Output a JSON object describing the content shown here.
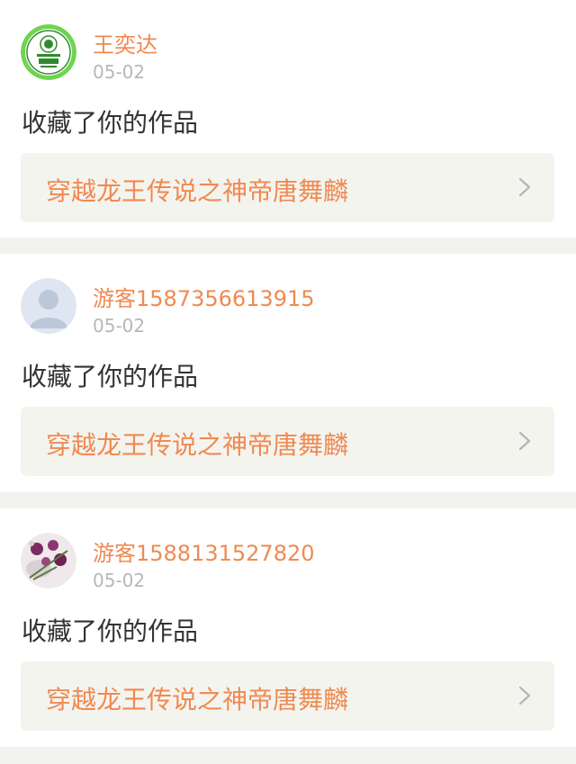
{
  "notifications": [
    {
      "avatar_icon": "green-seal-avatar-icon",
      "username": "王奕达",
      "date": "05-02",
      "action": "收藏了你的作品",
      "work_title": "穿越龙王传说之神帝唐舞麟"
    },
    {
      "avatar_icon": "default-user-avatar-icon",
      "username": "游客1587356613915",
      "date": "05-02",
      "action": "收藏了你的作品",
      "work_title": "穿越龙王传说之神帝唐舞麟"
    },
    {
      "avatar_icon": "flower-photo-avatar-icon",
      "username": "游客1588131527820",
      "date": "05-02",
      "action": "收藏了你的作品",
      "work_title": "穿越龙王传说之神帝唐舞麟"
    }
  ],
  "colors": {
    "accent": "#ef8a52",
    "date": "#b7b7b7",
    "text": "#333333",
    "link_bg": "#f4f4ef",
    "page_bg": "#f2f2f0"
  }
}
